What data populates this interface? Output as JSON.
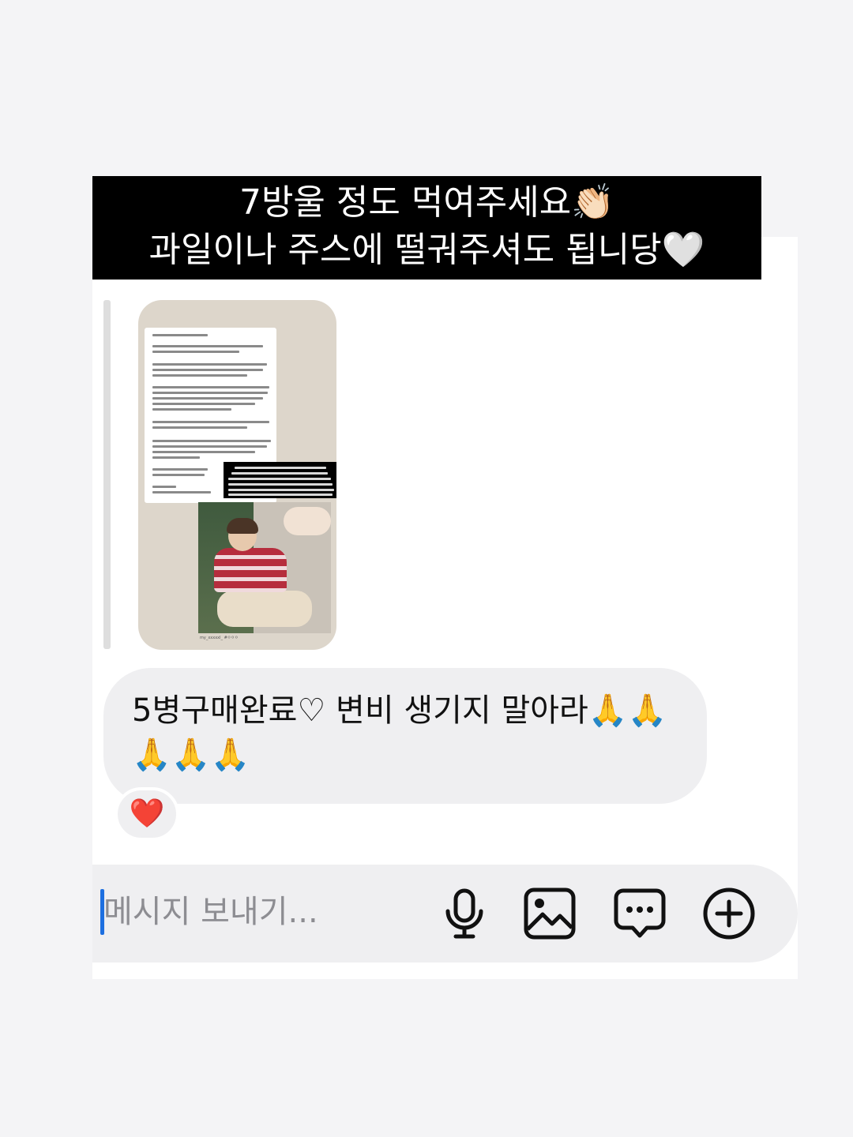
{
  "caption": {
    "line1": "7방울 정도 먹여주세요👏🏻",
    "line2": "과일이나 주스에 떨궈주셔도 됩니당🤍"
  },
  "story": {
    "credit": "my_xxxxxl_ #ㅇㅇㅇ"
  },
  "message": {
    "text": "5병구매완료♡  변비 생기지 말아라🙏🙏🙏🙏🙏",
    "reaction": "❤️"
  },
  "composer": {
    "placeholder": "메시지 보내기...",
    "icons": [
      "microphone-icon",
      "image-icon",
      "chat-bubble-icon",
      "plus-circle-icon"
    ]
  }
}
